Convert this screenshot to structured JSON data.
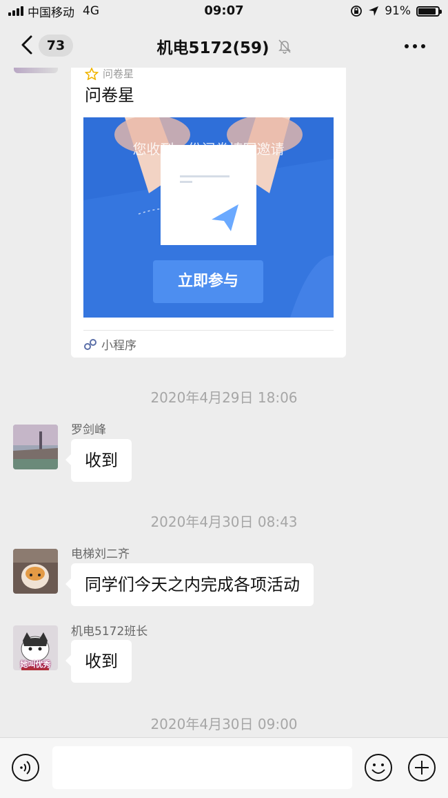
{
  "status_bar": {
    "carrier": "中国移动",
    "network": "4G",
    "time": "09:07",
    "battery": "91%",
    "battery_level": 0.91
  },
  "header": {
    "unread_count": "73",
    "title": "机电5172(59)"
  },
  "card": {
    "source_label": "问卷星",
    "title": "问卷星",
    "image_caption": "您收到一份问卷填写邀请",
    "image_button": "立即参与",
    "footer_label": "小程序"
  },
  "messages": [
    {
      "timestamp": "2020年4月29日 18:06",
      "sender": "罗剑峰",
      "text": "收到"
    },
    {
      "timestamp": "2020年4月30日 08:43",
      "sender": "电梯刘二齐",
      "text": "同学们今天之内完成各项活动"
    },
    {
      "sender": "机电5172班长",
      "text": "收到",
      "avatar_caption": "她叫优秀"
    }
  ],
  "last_timestamp": "2020年4月30日 09:00",
  "colors": {
    "background": "#ededed",
    "bubble": "#ffffff",
    "card_blue": "#2f6fd9",
    "timestamp": "#a6a6a6"
  }
}
